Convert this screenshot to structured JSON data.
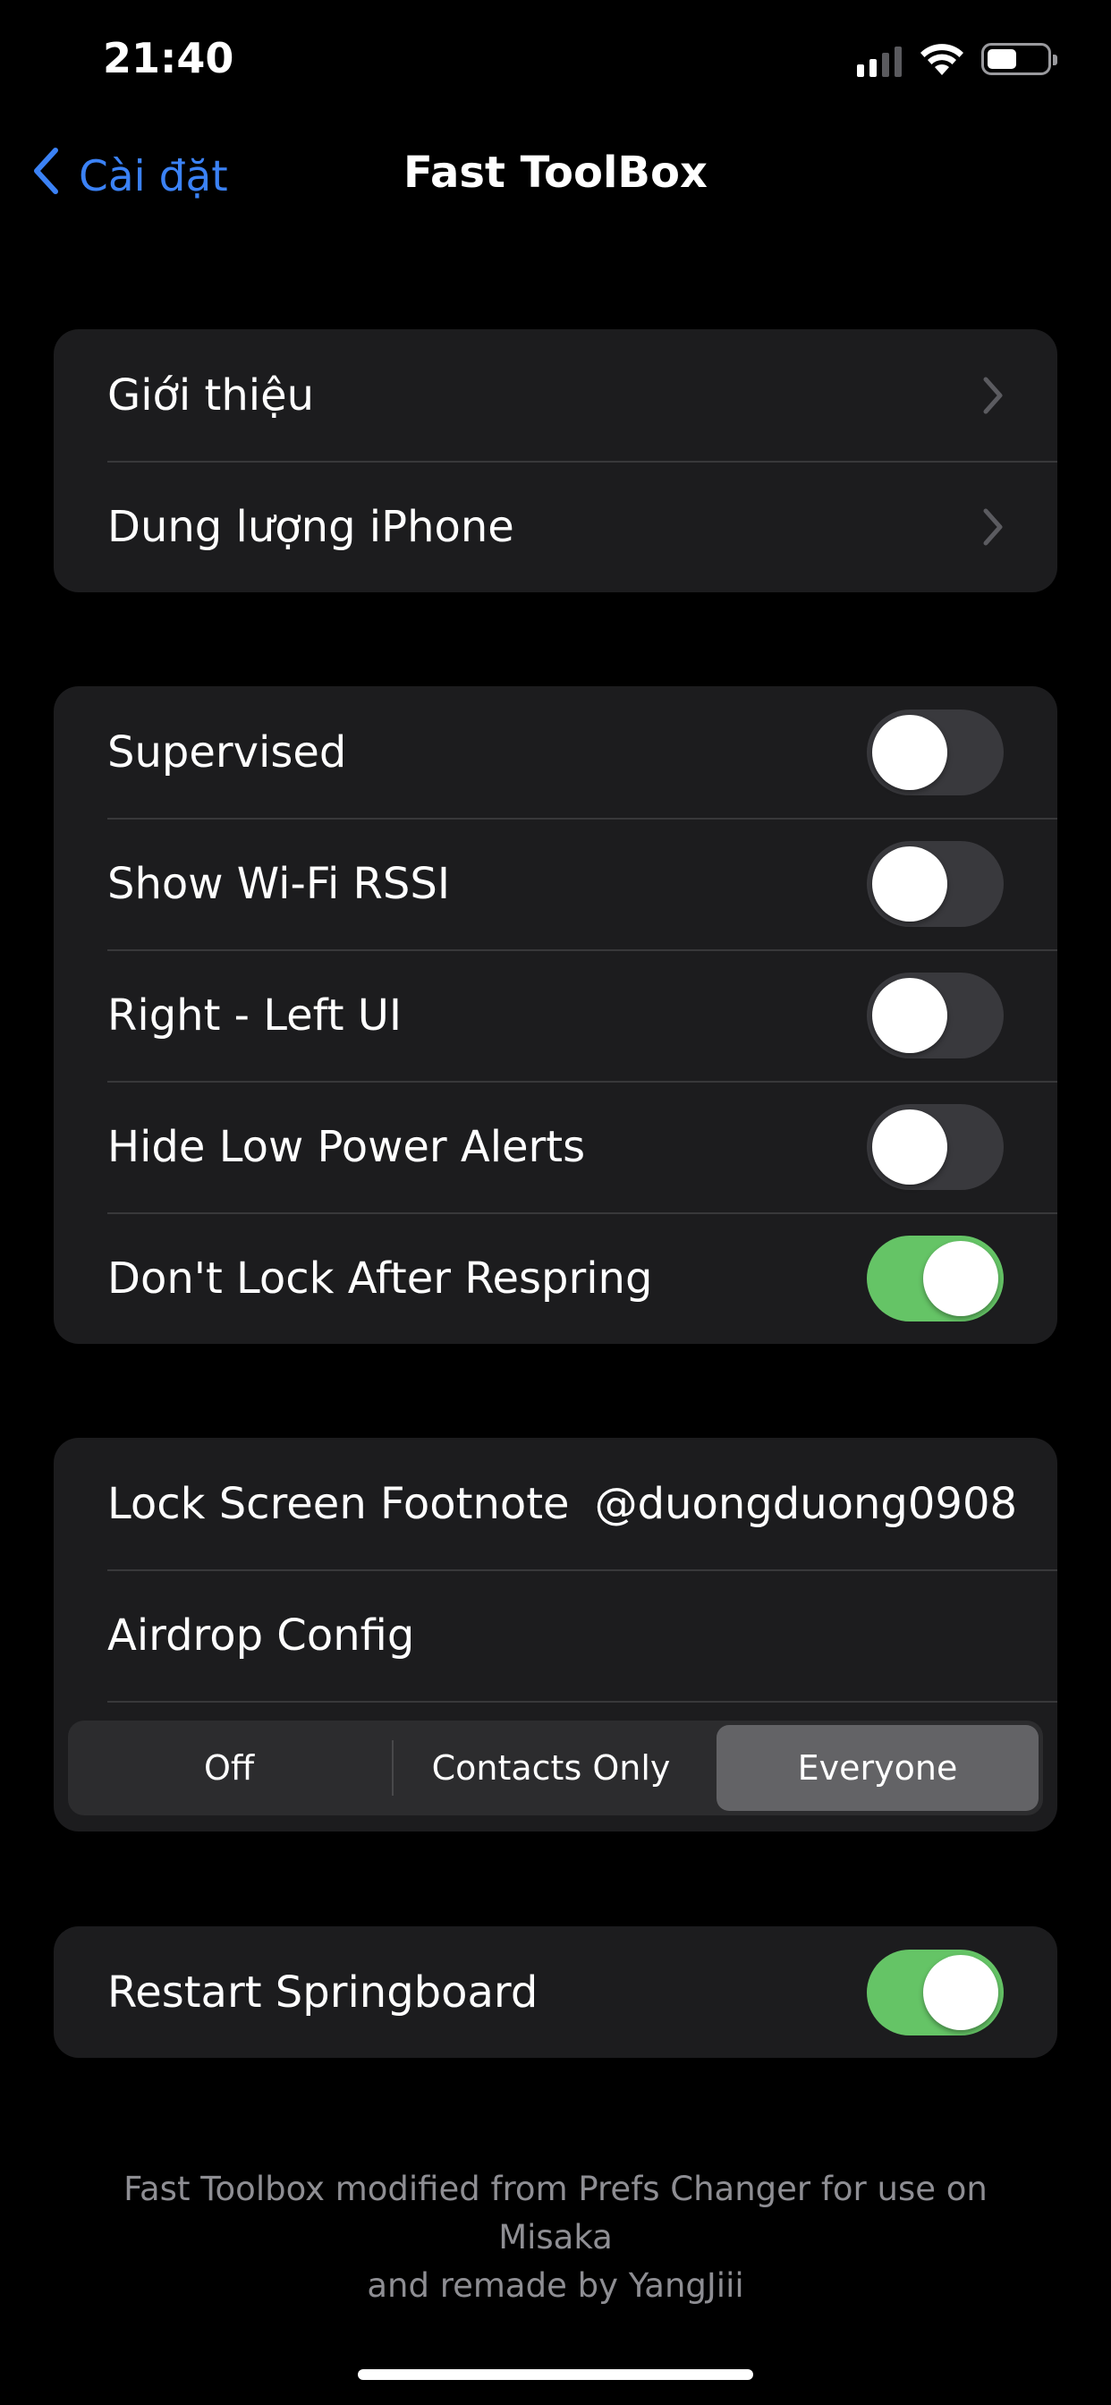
{
  "status_bar": {
    "time": "21:40"
  },
  "nav": {
    "back_label": "Cài đặt",
    "title": "Fast ToolBox"
  },
  "group1": {
    "items": [
      {
        "label": "Giới thiệu"
      },
      {
        "label": "Dung lượng iPhone"
      }
    ]
  },
  "group2": {
    "items": [
      {
        "label": "Supervised",
        "enabled": false
      },
      {
        "label": "Show Wi-Fi RSSI",
        "enabled": false
      },
      {
        "label": "Right - Left UI",
        "enabled": false
      },
      {
        "label": "Hide Low Power Alerts",
        "enabled": false
      },
      {
        "label": "Don't Lock After Respring",
        "enabled": true
      }
    ]
  },
  "group3": {
    "footnote_label": "Lock Screen Footnote",
    "footnote_value": "@duongduong0908",
    "airdrop_label": "Airdrop Config",
    "airdrop_options": [
      "Off",
      "Contacts Only",
      "Everyone"
    ],
    "airdrop_selected": "Everyone"
  },
  "group4": {
    "label": "Restart Springboard",
    "enabled": true
  },
  "footer": {
    "line1": "Fast Toolbox modified from Prefs Changer for use on Misaka",
    "line2": "and remade by YangJiii"
  },
  "colors": {
    "accent": "#3b82f6",
    "toggle_on": "#65c466",
    "toggle_off": "#39393d",
    "cell_bg": "#1c1c1e"
  }
}
